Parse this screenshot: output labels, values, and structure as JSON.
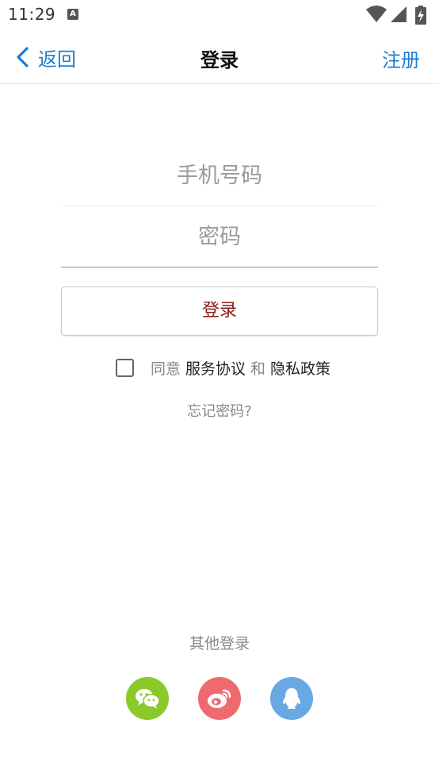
{
  "status_bar": {
    "time": "11:29",
    "notification_icon": "A"
  },
  "nav": {
    "back_label": "返回",
    "title": "登录",
    "register_label": "注册"
  },
  "form": {
    "phone_placeholder": "手机号码",
    "password_placeholder": "密码",
    "login_label": "登录"
  },
  "agreement": {
    "prefix": "同意",
    "service_terms": "服务协议",
    "conjunction": "和",
    "privacy_policy": "隐私政策"
  },
  "forgot_password": "忘记密码?",
  "other_login": {
    "label": "其他登录",
    "providers": [
      {
        "name": "wechat",
        "icon": "wechat-icon",
        "color": "#8ac929"
      },
      {
        "name": "weibo",
        "icon": "weibo-icon",
        "color": "#ef6a6f"
      },
      {
        "name": "qq",
        "icon": "qq-icon",
        "color": "#6aa8e4"
      }
    ]
  },
  "colors": {
    "accent": "#1a7fd4",
    "login_text": "#8b1a1a"
  }
}
